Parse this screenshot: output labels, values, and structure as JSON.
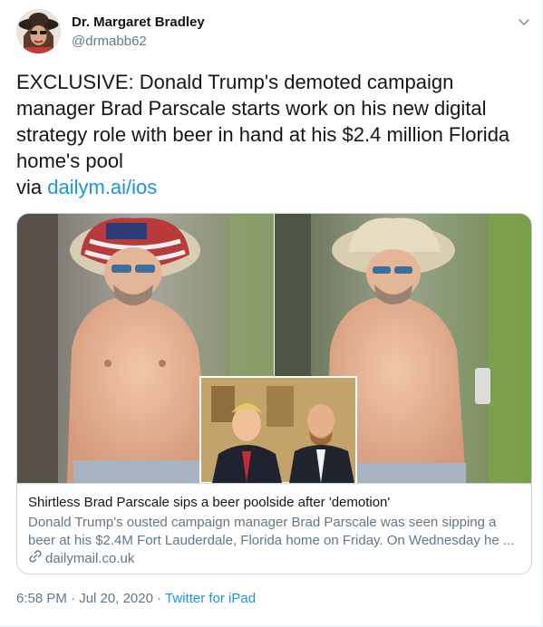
{
  "author": {
    "display_name": "Dr. Margaret Bradley",
    "handle": "@drmabb62"
  },
  "tweet": {
    "text": "EXCLUSIVE: Donald Trump's demoted campaign manager Brad Parscale starts work on his new digital strategy role with beer in hand at his $2.4 million Florida home's pool",
    "via_label": "via",
    "link_text": "dailym.ai/ios"
  },
  "card": {
    "title": "Shirtless Brad Parscale sips a beer poolside after 'demotion'",
    "description": "Donald Trump's ousted campaign manager Brad Parscale was seen sipping a beer at his $2.4M Fort Lauderdale, Florida home on Friday. On Wednesday he ...",
    "domain": "dailymail.co.uk"
  },
  "meta": {
    "time": "6:58 PM",
    "separator1": "·",
    "date": "Jul 20, 2020",
    "separator2": "·",
    "source": "Twitter for iPad"
  },
  "icons": {
    "caret": "chevron-down-icon",
    "link": "link-icon"
  },
  "colors": {
    "link": "#1b95e0",
    "secondary_text": "#657786",
    "border": "#ccd6dd"
  }
}
